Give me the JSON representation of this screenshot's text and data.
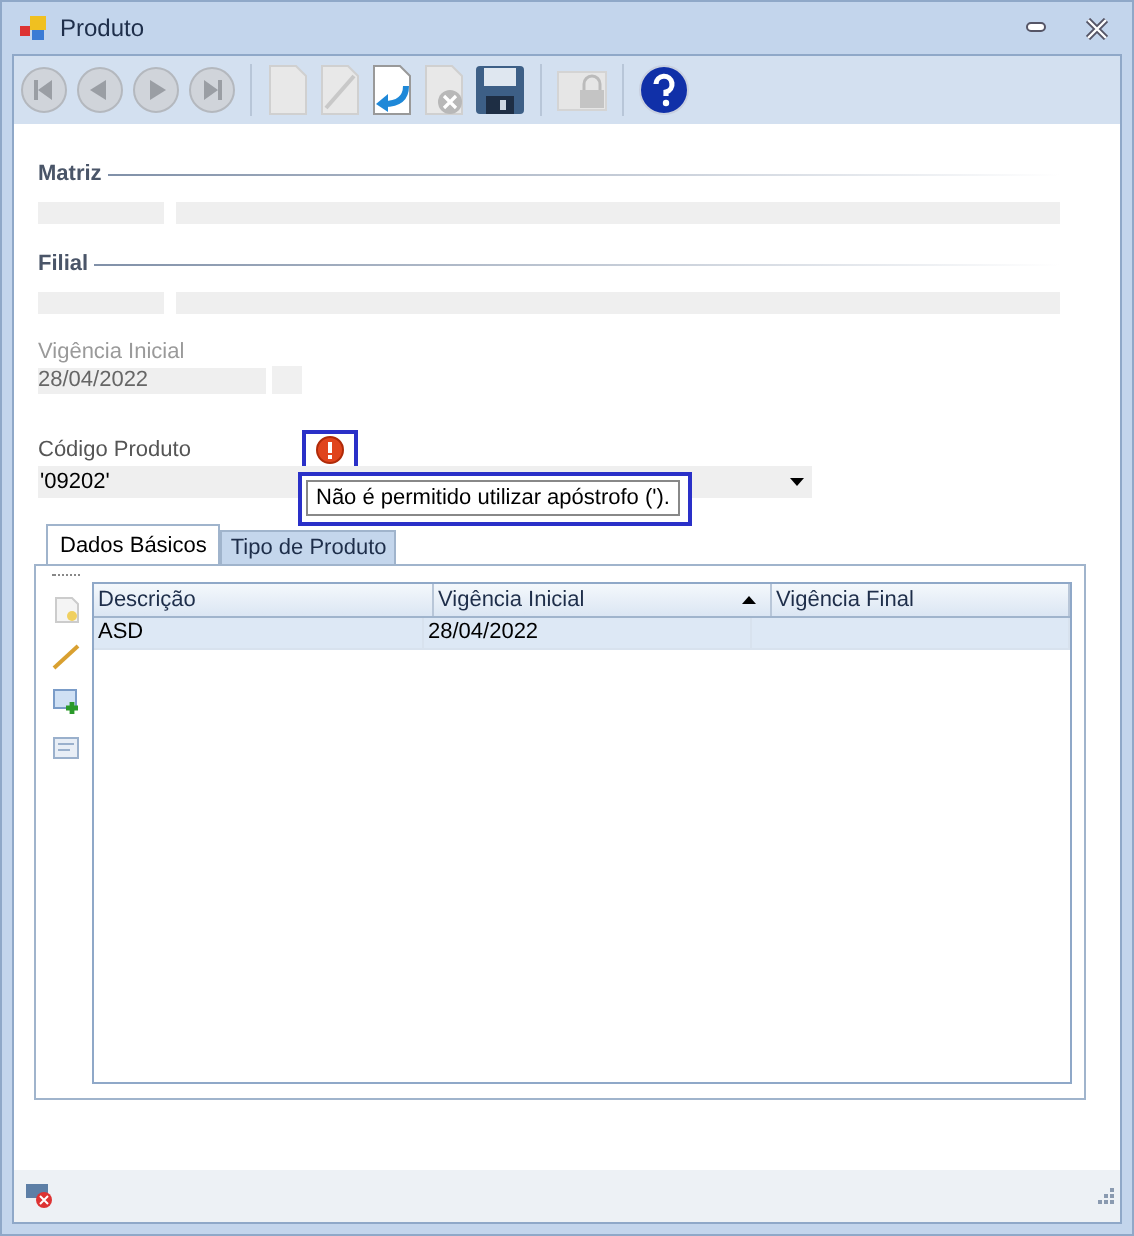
{
  "window": {
    "title": "Produto"
  },
  "toolbar": [
    {
      "kind": "first",
      "disabled": true
    },
    {
      "kind": "prev",
      "disabled": true
    },
    {
      "kind": "next",
      "disabled": true
    },
    {
      "kind": "last",
      "disabled": true
    },
    {
      "kind": "sep"
    },
    {
      "kind": "new",
      "disabled": true
    },
    {
      "kind": "edit",
      "disabled": true
    },
    {
      "kind": "undo",
      "disabled": false
    },
    {
      "kind": "delete",
      "disabled": true
    },
    {
      "kind": "save",
      "disabled": false
    },
    {
      "kind": "sep"
    },
    {
      "kind": "lock",
      "disabled": true
    },
    {
      "kind": "sep"
    },
    {
      "kind": "help",
      "disabled": false
    }
  ],
  "sections": [
    {
      "title": "Matriz"
    },
    {
      "title": "Filial"
    }
  ],
  "vigencia": {
    "label": "Vigência Inicial",
    "value": "28/04/2022",
    "disabled": true
  },
  "codigo": {
    "label": "Código Produto",
    "value": "'09202'",
    "error": true
  },
  "tooltip": "Não é permitido utilizar apóstrofo (').",
  "tabs": [
    {
      "label": "Dados Básicos",
      "selected": true
    },
    {
      "label": "Tipo de Produto",
      "selected": false
    }
  ],
  "side_tools": [
    {
      "kind": "new"
    },
    {
      "kind": "edit"
    },
    {
      "kind": "add"
    },
    {
      "kind": "view"
    }
  ],
  "table": {
    "columns": [
      {
        "label": "Descrição",
        "sorted": false
      },
      {
        "label": "Vigência Inicial",
        "sorted": true
      },
      {
        "label": "Vigência Final",
        "sorted": false
      }
    ],
    "rows": [
      {
        "cells": [
          "ASD",
          "28/04/2022",
          ""
        ],
        "selected": true
      }
    ]
  }
}
